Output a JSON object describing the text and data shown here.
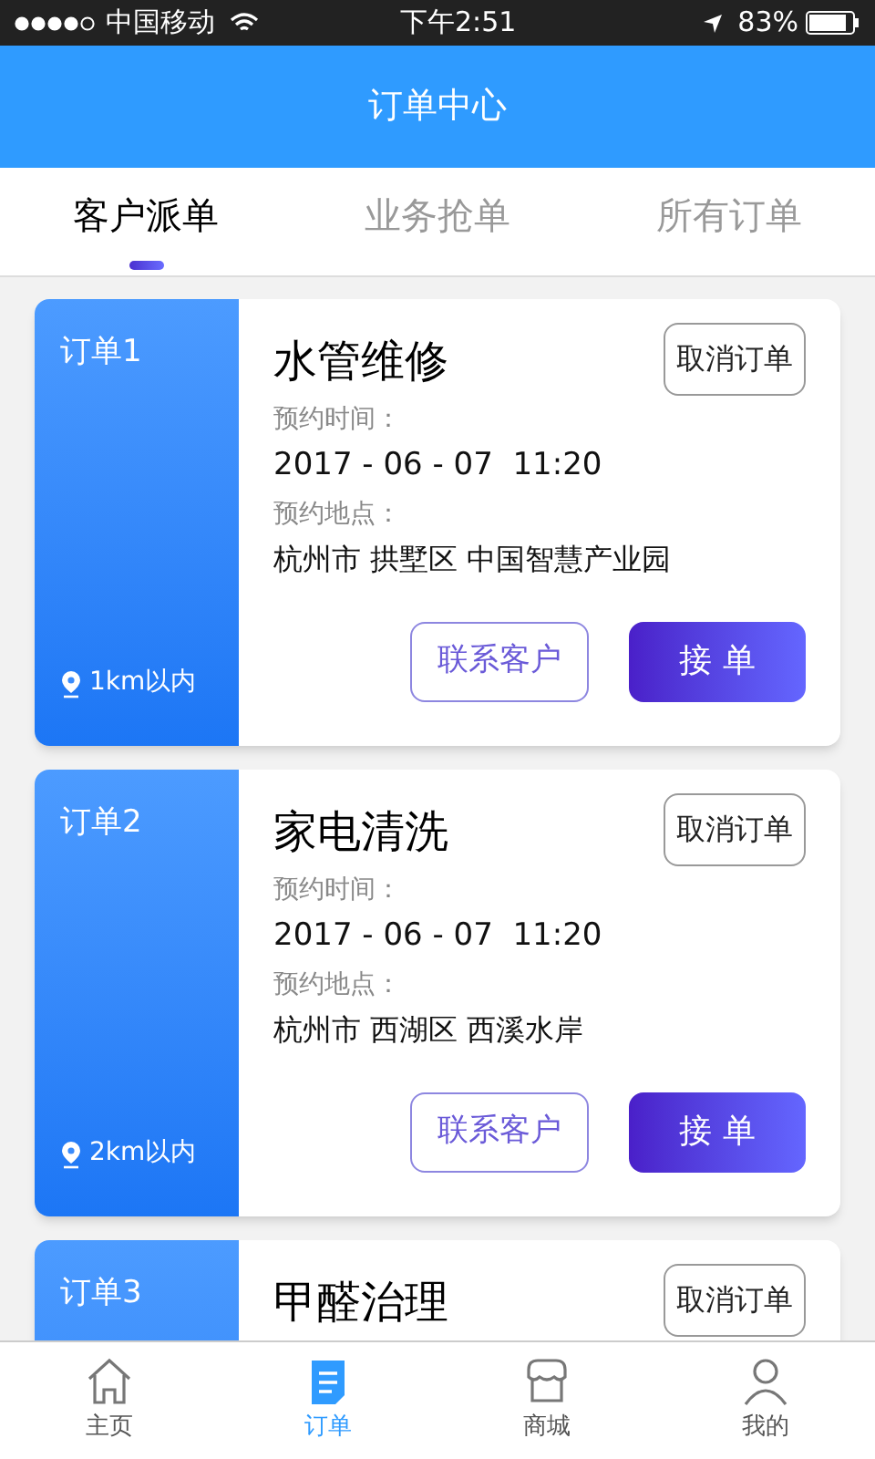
{
  "status_bar": {
    "carrier": "中国移动",
    "time": "下午2:51",
    "battery": "83%"
  },
  "header": {
    "title": "订单中心"
  },
  "tabs": [
    {
      "label": "客户派单",
      "selected": true
    },
    {
      "label": "业务抢单",
      "selected": false
    },
    {
      "label": "所有订单",
      "selected": false
    }
  ],
  "orders": [
    {
      "tag": "订单1",
      "title": "水管维修",
      "cancel": "取消订单",
      "time_label": "预约时间：",
      "time": "2017 - 06 - 07  11:20",
      "place_label": "预约地点：",
      "place": "杭州市 拱墅区 中国智慧产业园",
      "distance": "1km以内",
      "contact": "联系客户",
      "accept": "接 单"
    },
    {
      "tag": "订单2",
      "title": "家电清洗",
      "cancel": "取消订单",
      "time_label": "预约时间：",
      "time": "2017 - 06 - 07  11:20",
      "place_label": "预约地点：",
      "place": "杭州市 西湖区 西溪水岸",
      "distance": "2km以内",
      "contact": "联系客户",
      "accept": "接 单"
    },
    {
      "tag": "订单3",
      "title": "甲醛治理",
      "cancel": "取消订单"
    }
  ],
  "nav": [
    {
      "label": "主页",
      "kind": "home",
      "selected": false
    },
    {
      "label": "订单",
      "kind": "order",
      "selected": true
    },
    {
      "label": "商城",
      "kind": "shop",
      "selected": false
    },
    {
      "label": "我的",
      "kind": "user",
      "selected": false
    }
  ]
}
